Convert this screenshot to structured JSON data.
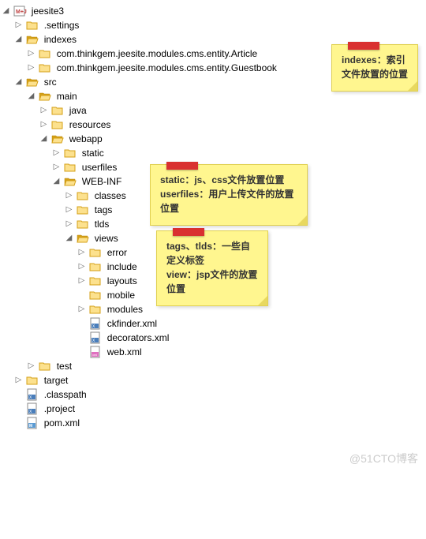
{
  "tree": {
    "root": "jeesite3",
    "settings": ".settings",
    "indexes": "indexes",
    "indexes_c": {
      "article": "com.thinkgem.jeesite.modules.cms.entity.Article",
      "guestbook": "com.thinkgem.jeesite.modules.cms.entity.Guestbook"
    },
    "src": "src",
    "main": "main",
    "java": "java",
    "resources": "resources",
    "webapp": "webapp",
    "static": "static",
    "userfiles": "userfiles",
    "webinf": "WEB-INF",
    "classes": "classes",
    "tags": "tags",
    "tlds": "tlds",
    "views": "views",
    "error": "error",
    "include": "include",
    "layouts": "layouts",
    "mobile": "mobile",
    "modules": "modules",
    "ckfinder": "ckfinder.xml",
    "decorators": "decorators.xml",
    "webxml": "web.xml",
    "test": "test",
    "target": "target",
    "classpath": ".classpath",
    "project": ".project",
    "pom": "pom.xml"
  },
  "notes": {
    "n1": "indexes：索引文件放置的位置",
    "n2a": "static：js、css文件放置位置",
    "n2b": "userfiles：用户上传文件的放置位置",
    "n3a": "tags、tlds：一些自定义标签",
    "n3b": "view：jsp文件的放置位置"
  },
  "watermark": "@51CTO博客"
}
